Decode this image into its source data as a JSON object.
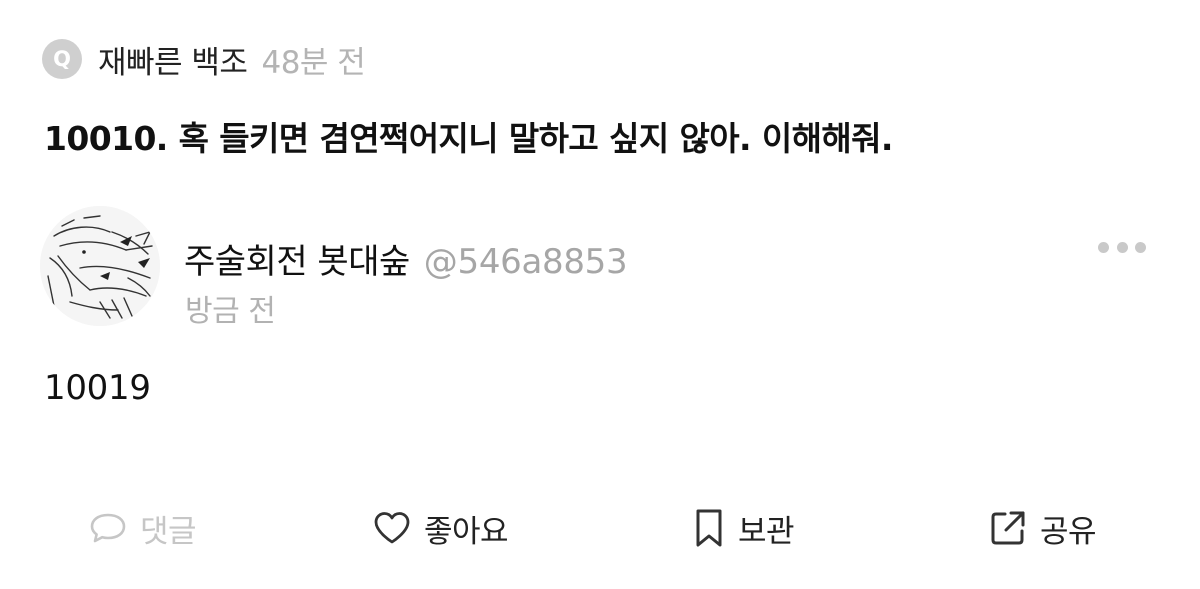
{
  "question": {
    "badge": "Q",
    "asker": "재빠른 백조",
    "time": "48분 전",
    "text": "10010. 혹 들키면 겸연쩍어지니 말하고 싶지 않아. 이해해줘."
  },
  "answer": {
    "author_name": "주술회전 봇대숲",
    "author_handle": "@546a8853",
    "time": "방금 전",
    "text": "10019"
  },
  "actions": {
    "comment": "댓글",
    "like": "좋아요",
    "save": "보관",
    "share": "공유"
  },
  "icons": {
    "more": "more-dots-icon",
    "comment": "comment-bubble-icon",
    "like": "heart-icon",
    "save": "bookmark-icon",
    "share": "share-external-icon"
  },
  "colors": {
    "badge_bg": "#cfcfcf",
    "muted_text": "#b2b2b2",
    "disabled_action": "#c6c6c6",
    "primary_text": "#111111"
  }
}
